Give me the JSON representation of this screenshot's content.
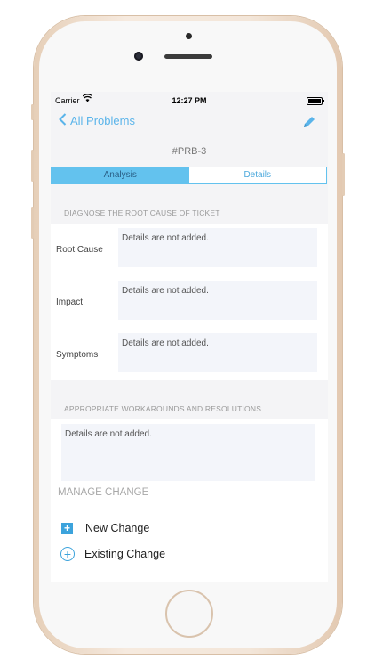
{
  "status_bar": {
    "carrier": "Carrier",
    "time": "12:27 PM"
  },
  "nav": {
    "back_label": "All Problems"
  },
  "ticket": {
    "id": "#PRB-3"
  },
  "tabs": [
    {
      "label": "Analysis",
      "active": true
    },
    {
      "label": "Details",
      "active": false
    }
  ],
  "root_cause_section": {
    "header": "DIAGNOSE THE ROOT CAUSE OF TICKET",
    "rows": [
      {
        "label": "Root Cause",
        "value": "Details are not added."
      },
      {
        "label": "Impact",
        "value": "Details are not added."
      },
      {
        "label": "Symptoms",
        "value": "Details are not added."
      }
    ]
  },
  "workaround_section": {
    "header": "APPROPRIATE WORKAROUNDS AND RESOLUTIONS",
    "value": "Details are not added."
  },
  "manage_change": {
    "header": "MANAGE CHANGE",
    "new_change_label": "New Change",
    "existing_change_label": "Existing Change"
  },
  "colors": {
    "accent": "#5ab4ea",
    "segment_active": "#63c2ee",
    "field_bg": "#f3f5fa"
  }
}
